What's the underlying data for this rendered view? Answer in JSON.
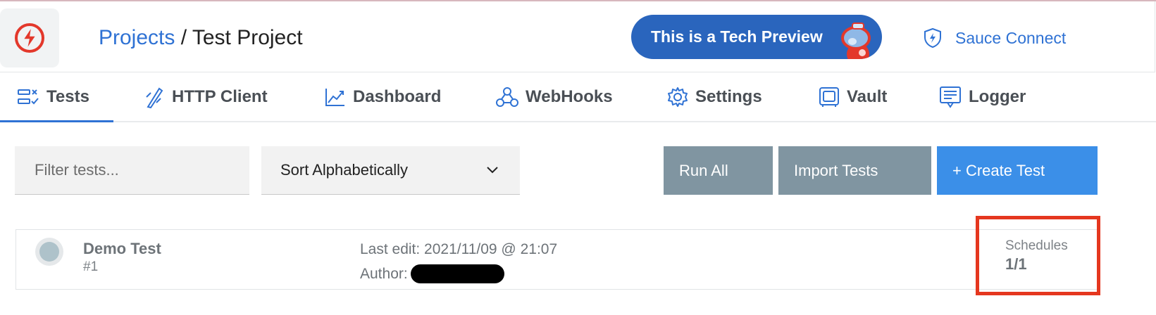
{
  "header": {
    "breadcrumb": {
      "link": "Projects",
      "separator": " / ",
      "current": "Test Project"
    },
    "preview_button": "This is a Tech Preview",
    "sauce_connect": "Sauce Connect"
  },
  "tabs": [
    {
      "label": "Tests",
      "icon": "tests-icon",
      "active": true
    },
    {
      "label": "HTTP Client",
      "icon": "http-client-icon"
    },
    {
      "label": "Dashboard",
      "icon": "dashboard-chart-icon"
    },
    {
      "label": "WebHooks",
      "icon": "webhooks-icon"
    },
    {
      "label": "Settings",
      "icon": "gear-icon"
    },
    {
      "label": "Vault",
      "icon": "vault-icon"
    },
    {
      "label": "Logger",
      "icon": "logger-icon"
    }
  ],
  "toolbar": {
    "filter_placeholder": "Filter tests...",
    "sort_value": "Sort Alphabetically",
    "run_all": "Run All",
    "import_tests": "Import Tests",
    "create_test": "+ Create Test"
  },
  "tests": [
    {
      "name": "Demo Test",
      "number": "#1",
      "last_edit": "Last edit: 2021/11/09 @ 21:07",
      "author_label": "Author:",
      "schedules_label": "Schedules",
      "schedules_value": "1/1"
    }
  ],
  "colors": {
    "accent": "#2f72d4",
    "preview_button": "#2a65bd",
    "gray_button": "#8095a1",
    "create_button": "#3b8fe8",
    "highlight": "#e5371f"
  }
}
